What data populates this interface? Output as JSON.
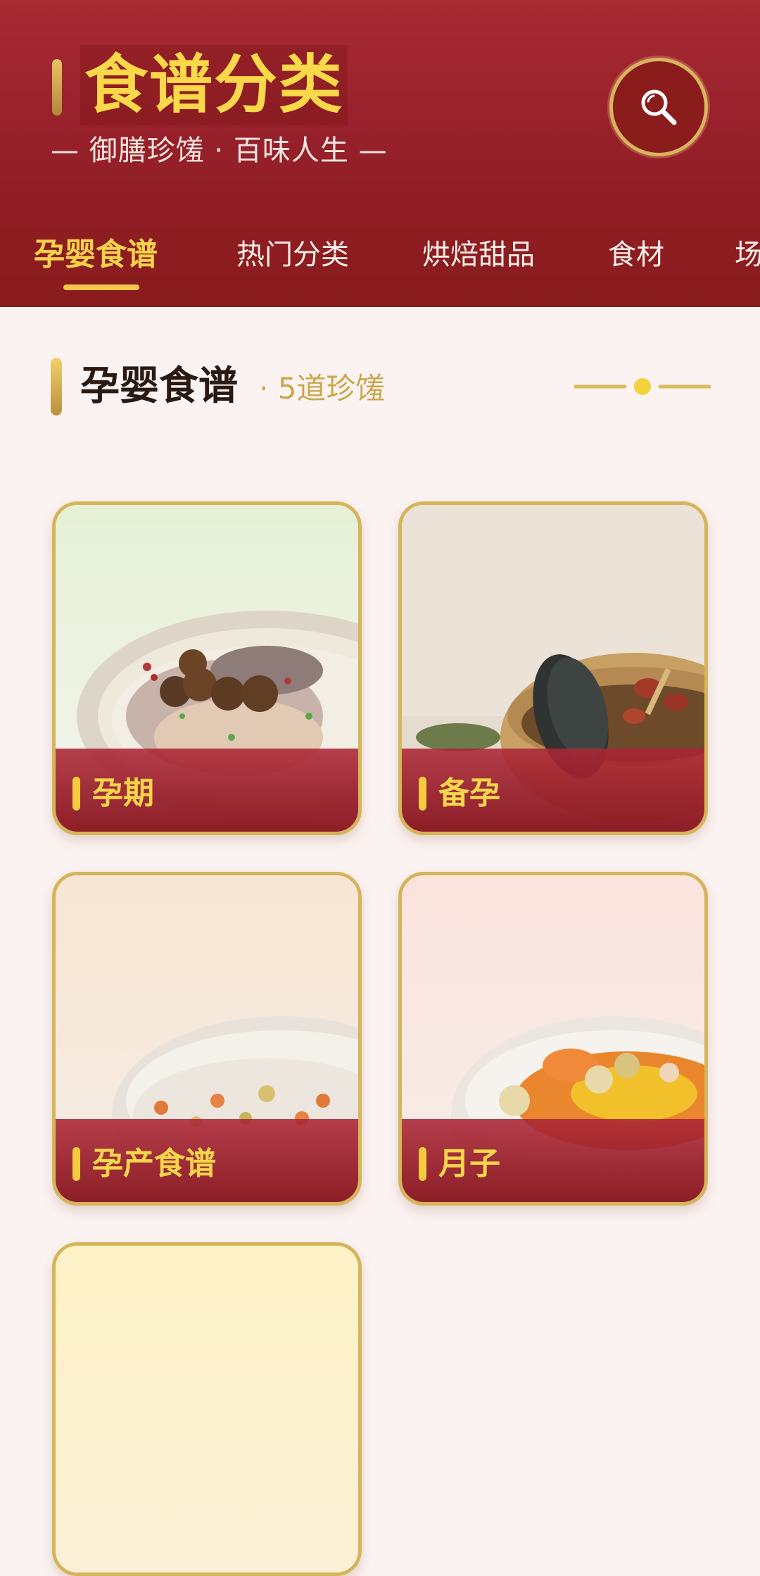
{
  "header": {
    "title": "食谱分类",
    "subtitle": "— 御膳珍馐 · 百味人生 —"
  },
  "tabs": [
    {
      "label": "孕婴食谱",
      "active": true
    },
    {
      "label": "热门分类",
      "active": false
    },
    {
      "label": "烘焙甜品",
      "active": false
    },
    {
      "label": "食材",
      "active": false
    },
    {
      "label": "场",
      "active": false
    }
  ],
  "section": {
    "title": "孕婴食谱",
    "count": "· 5道珍馐"
  },
  "cards": [
    {
      "label": "孕期"
    },
    {
      "label": "备孕"
    },
    {
      "label": "孕产食谱"
    },
    {
      "label": "月子"
    },
    {
      "label": ""
    }
  ],
  "colors": {
    "header_red": "#96202a",
    "gold": "#f6d24a",
    "card_border": "#d6b45a",
    "page_bg": "#fbf3f1"
  }
}
